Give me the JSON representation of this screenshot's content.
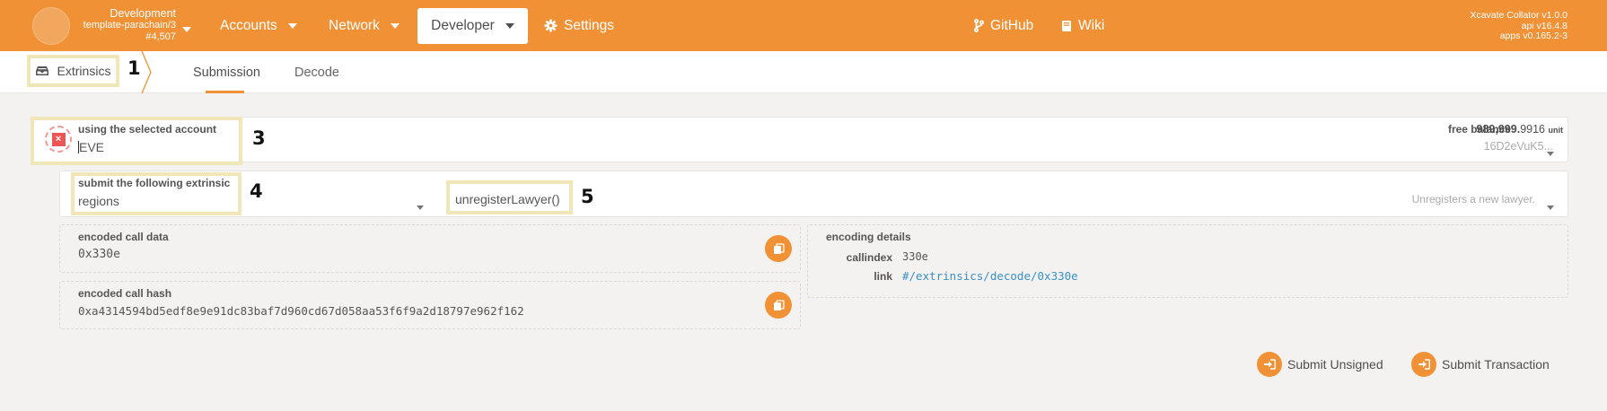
{
  "header": {
    "chain_name": "Development",
    "chain_runtime": "template-parachain/3",
    "block_number": "#4,507",
    "nav": {
      "accounts": "Accounts",
      "network": "Network",
      "developer": "Developer",
      "settings": "Settings",
      "github": "GitHub",
      "wiki": "Wiki"
    },
    "versions": {
      "node": "Xcavate Collator v1.0.0",
      "api": "api v16.4.8",
      "apps": "apps v0.165.2-3"
    },
    "accent_color": "#f19135"
  },
  "tabbar": {
    "section": "Extrinsics",
    "tabs": [
      "Submission",
      "Decode"
    ],
    "active_tab": "Submission"
  },
  "annotations": [
    "1",
    "3",
    "4",
    "5"
  ],
  "account": {
    "label": "using the selected account",
    "value": "EVE",
    "free_balance_label": "free balance",
    "balance_int": "989,999.",
    "balance_frac": "9916",
    "balance_unit": "unit",
    "address": "16D2eVuK5..."
  },
  "extrinsic": {
    "label": "submit the following extrinsic",
    "pallet": "regions",
    "call": "unregisterLawyer()",
    "description": "Unregisters a new lawyer."
  },
  "encoded_call_data": {
    "label": "encoded call data",
    "value": "0x330e"
  },
  "encoded_call_hash": {
    "label": "encoded call hash",
    "value": "0xa4314594bd5edf8e9e91dc83baf7d960cd67d058aa53f6f9a2d18797e962f162"
  },
  "encoding_details": {
    "label": "encoding details",
    "callindex_label": "callindex",
    "callindex_value": "330e",
    "link_label": "link",
    "link_value": "#/extrinsics/decode/0x330e"
  },
  "actions": {
    "submit_unsigned": "Submit Unsigned",
    "submit_transaction": "Submit Transaction"
  }
}
